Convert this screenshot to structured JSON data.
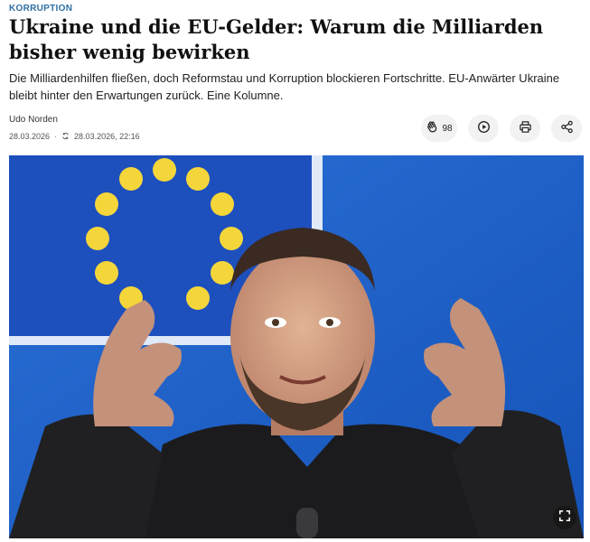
{
  "article": {
    "kicker": "KORRUPTION",
    "headline": "Ukraine und die EU-Gelder: Warum die Milliarden bisher wenig bewirken",
    "teaser": "Die Milliardenhilfen fließen, doch Reformstau und Korruption blockieren Fortschritte. EU-Anwärter Ukraine bleibt hinter den Erwartungen zurück. Eine Kolumne.",
    "author": "Udo Norden",
    "published": "28.03.2026",
    "separator": "·",
    "updated": "28.03.2026, 22:16"
  },
  "actions": {
    "clap_count": "98",
    "icons": [
      "clap-icon",
      "play-icon",
      "print-icon",
      "share-icon"
    ]
  },
  "image": {
    "icons": [
      "expand-icon"
    ]
  },
  "colors": {
    "kicker": "#2f6fa3",
    "eu_blue": "#1f5fc4",
    "eu_star": "#f5d63a"
  }
}
